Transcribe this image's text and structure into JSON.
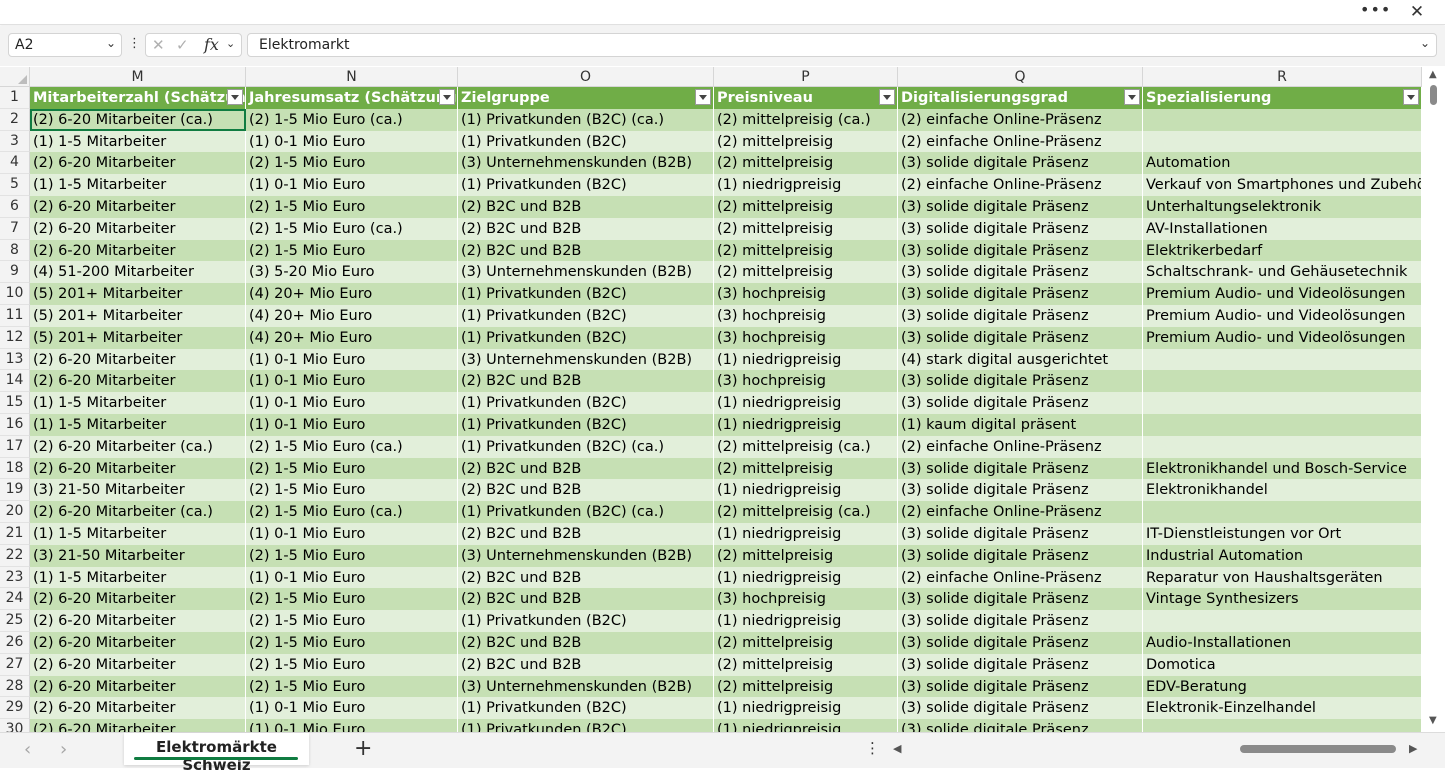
{
  "window": {
    "more_glyph": "•••",
    "close_glyph": "✕"
  },
  "formula_bar": {
    "name_box": "A2",
    "formula": "Elektromarkt",
    "fx_label": "fx"
  },
  "columns": [
    "M",
    "N",
    "O",
    "P",
    "Q",
    "R"
  ],
  "headers": [
    "Mitarbeiterzahl (Schätzung)",
    "Jahresumsatz (Schätzung)",
    "Zielgruppe",
    "Preisniveau",
    "Digitalisierungsgrad",
    "Spezialisierung"
  ],
  "rows": [
    {
      "n": "2",
      "cells": [
        "(2) 6-20 Mitarbeiter (ca.)",
        "(2) 1-5 Mio Euro (ca.)",
        "(1) Privatkunden (B2C) (ca.)",
        "(2) mittelpreisig (ca.)",
        "(2) einfache Online-Präsenz",
        ""
      ]
    },
    {
      "n": "3",
      "cells": [
        "(1) 1-5 Mitarbeiter",
        "(1) 0-1 Mio Euro",
        "(1) Privatkunden (B2C)",
        "(2) mittelpreisig",
        "(2) einfache Online-Präsenz",
        ""
      ]
    },
    {
      "n": "4",
      "cells": [
        "(2) 6-20 Mitarbeiter",
        "(2) 1-5 Mio Euro",
        "(3) Unternehmenskunden (B2B)",
        "(2) mittelpreisig",
        "(3) solide digitale Präsenz",
        "Automation"
      ]
    },
    {
      "n": "5",
      "cells": [
        "(1) 1-5 Mitarbeiter",
        "(1) 0-1 Mio Euro",
        "(1) Privatkunden (B2C)",
        "(1) niedrigpreisig",
        "(2) einfache Online-Präsenz",
        "Verkauf von Smartphones und Zubehör"
      ]
    },
    {
      "n": "6",
      "cells": [
        "(2) 6-20 Mitarbeiter",
        "(2) 1-5 Mio Euro",
        "(2) B2C und B2B",
        "(2) mittelpreisig",
        "(3) solide digitale Präsenz",
        "Unterhaltungselektronik"
      ]
    },
    {
      "n": "7",
      "cells": [
        "(2) 6-20 Mitarbeiter",
        "(2) 1-5 Mio Euro (ca.)",
        "(2) B2C und B2B",
        "(2) mittelpreisig",
        "(3) solide digitale Präsenz",
        "AV-Installationen"
      ]
    },
    {
      "n": "8",
      "cells": [
        "(2) 6-20 Mitarbeiter",
        "(2) 1-5 Mio Euro",
        "(2) B2C und B2B",
        "(2) mittelpreisig",
        "(3) solide digitale Präsenz",
        "Elektrikerbedarf"
      ]
    },
    {
      "n": "9",
      "cells": [
        "(4) 51-200 Mitarbeiter",
        "(3) 5-20 Mio Euro",
        "(3) Unternehmenskunden (B2B)",
        "(2) mittelpreisig",
        "(3) solide digitale Präsenz",
        "Schaltschrank- und Gehäusetechnik"
      ]
    },
    {
      "n": "10",
      "cells": [
        "(5) 201+ Mitarbeiter",
        "(4) 20+ Mio Euro",
        "(1) Privatkunden (B2C)",
        "(3) hochpreisig",
        "(3) solide digitale Präsenz",
        "Premium Audio- und Videolösungen"
      ]
    },
    {
      "n": "11",
      "cells": [
        "(5) 201+ Mitarbeiter",
        "(4) 20+ Mio Euro",
        "(1) Privatkunden (B2C)",
        "(3) hochpreisig",
        "(3) solide digitale Präsenz",
        "Premium Audio- und Videolösungen"
      ]
    },
    {
      "n": "12",
      "cells": [
        "(5) 201+ Mitarbeiter",
        "(4) 20+ Mio Euro",
        "(1) Privatkunden (B2C)",
        "(3) hochpreisig",
        "(3) solide digitale Präsenz",
        "Premium Audio- und Videolösungen"
      ]
    },
    {
      "n": "13",
      "cells": [
        "(2) 6-20 Mitarbeiter",
        "(1) 0-1 Mio Euro",
        "(3) Unternehmenskunden (B2B)",
        "(1) niedrigpreisig",
        "(4) stark digital ausgerichtet",
        ""
      ]
    },
    {
      "n": "14",
      "cells": [
        "(2) 6-20 Mitarbeiter",
        "(1) 0-1 Mio Euro",
        "(2) B2C und B2B",
        "(3) hochpreisig",
        "(3) solide digitale Präsenz",
        ""
      ]
    },
    {
      "n": "15",
      "cells": [
        "(1) 1-5 Mitarbeiter",
        "(1) 0-1 Mio Euro",
        "(1) Privatkunden (B2C)",
        "(1) niedrigpreisig",
        "(3) solide digitale Präsenz",
        ""
      ]
    },
    {
      "n": "16",
      "cells": [
        "(1) 1-5 Mitarbeiter",
        "(1) 0-1 Mio Euro",
        "(1) Privatkunden (B2C)",
        "(1) niedrigpreisig",
        "(1) kaum digital präsent",
        ""
      ]
    },
    {
      "n": "17",
      "cells": [
        "(2) 6-20 Mitarbeiter (ca.)",
        "(2) 1-5 Mio Euro (ca.)",
        "(1) Privatkunden (B2C) (ca.)",
        "(2) mittelpreisig (ca.)",
        "(2) einfache Online-Präsenz",
        ""
      ]
    },
    {
      "n": "18",
      "cells": [
        "(2) 6-20 Mitarbeiter",
        "(2) 1-5 Mio Euro",
        "(2) B2C und B2B",
        "(2) mittelpreisig",
        "(3) solide digitale Präsenz",
        "Elektronikhandel und Bosch-Service"
      ]
    },
    {
      "n": "19",
      "cells": [
        "(3) 21-50 Mitarbeiter",
        "(2) 1-5 Mio Euro",
        "(2) B2C und B2B",
        "(1) niedrigpreisig",
        "(3) solide digitale Präsenz",
        "Elektronikhandel"
      ]
    },
    {
      "n": "20",
      "cells": [
        "(2) 6-20 Mitarbeiter (ca.)",
        "(2) 1-5 Mio Euro (ca.)",
        "(1) Privatkunden (B2C) (ca.)",
        "(2) mittelpreisig (ca.)",
        "(2) einfache Online-Präsenz",
        ""
      ]
    },
    {
      "n": "21",
      "cells": [
        "(1) 1-5 Mitarbeiter",
        "(1) 0-1 Mio Euro",
        "(2) B2C und B2B",
        "(1) niedrigpreisig",
        "(3) solide digitale Präsenz",
        "IT-Dienstleistungen vor Ort"
      ]
    },
    {
      "n": "22",
      "cells": [
        "(3) 21-50 Mitarbeiter",
        "(2) 1-5 Mio Euro",
        "(3) Unternehmenskunden (B2B)",
        "(2) mittelpreisig",
        "(3) solide digitale Präsenz",
        "Industrial Automation"
      ]
    },
    {
      "n": "23",
      "cells": [
        "(1) 1-5 Mitarbeiter",
        "(1) 0-1 Mio Euro",
        "(2) B2C und B2B",
        "(1) niedrigpreisig",
        "(2) einfache Online-Präsenz",
        "Reparatur von Haushaltsgeräten"
      ]
    },
    {
      "n": "24",
      "cells": [
        "(2) 6-20 Mitarbeiter",
        "(2) 1-5 Mio Euro",
        "(2) B2C und B2B",
        "(3) hochpreisig",
        "(3) solide digitale Präsenz",
        "Vintage Synthesizers"
      ]
    },
    {
      "n": "25",
      "cells": [
        "(2) 6-20 Mitarbeiter",
        "(2) 1-5 Mio Euro",
        "(1) Privatkunden (B2C)",
        "(1) niedrigpreisig",
        "(3) solide digitale Präsenz",
        ""
      ]
    },
    {
      "n": "26",
      "cells": [
        "(2) 6-20 Mitarbeiter",
        "(2) 1-5 Mio Euro",
        "(2) B2C und B2B",
        "(2) mittelpreisig",
        "(3) solide digitale Präsenz",
        "Audio-Installationen"
      ]
    },
    {
      "n": "27",
      "cells": [
        "(2) 6-20 Mitarbeiter",
        "(2) 1-5 Mio Euro",
        "(2) B2C und B2B",
        "(2) mittelpreisig",
        "(3) solide digitale Präsenz",
        "Domotica"
      ]
    },
    {
      "n": "28",
      "cells": [
        "(2) 6-20 Mitarbeiter",
        "(2) 1-5 Mio Euro",
        "(3) Unternehmenskunden (B2B)",
        "(2) mittelpreisig",
        "(3) solide digitale Präsenz",
        "EDV-Beratung"
      ]
    },
    {
      "n": "29",
      "cells": [
        "(2) 6-20 Mitarbeiter",
        "(1) 0-1 Mio Euro",
        "(1) Privatkunden (B2C)",
        "(1) niedrigpreisig",
        "(3) solide digitale Präsenz",
        "Elektronik-Einzelhandel"
      ]
    },
    {
      "n": "30",
      "cells": [
        "(2) 6-20 Mitarbeiter",
        "(1) 0-1 Mio Euro",
        "(1) Privatkunden (B2C)",
        "(1) niedrigpreisig",
        "(3) solide digitale Präsenz",
        ""
      ]
    }
  ],
  "sheet_tabs": [
    {
      "label": "Elektromärkte Schweiz",
      "active": true
    }
  ],
  "colors": {
    "header_green": "#70ad47",
    "band_dark": "#c6e0b4",
    "band_light": "#e2efda",
    "accent": "#107c41"
  },
  "icons": [
    "more-options-icon",
    "close-icon",
    "chevron-down-icon",
    "kebab-icon",
    "cancel-icon",
    "checkmark-icon",
    "function-icon",
    "filter-dropdown-icon",
    "scroll-up-icon",
    "scroll-down-icon",
    "scroll-left-icon",
    "scroll-right-icon",
    "previous-sheet-icon",
    "next-sheet-icon",
    "add-sheet-icon"
  ]
}
